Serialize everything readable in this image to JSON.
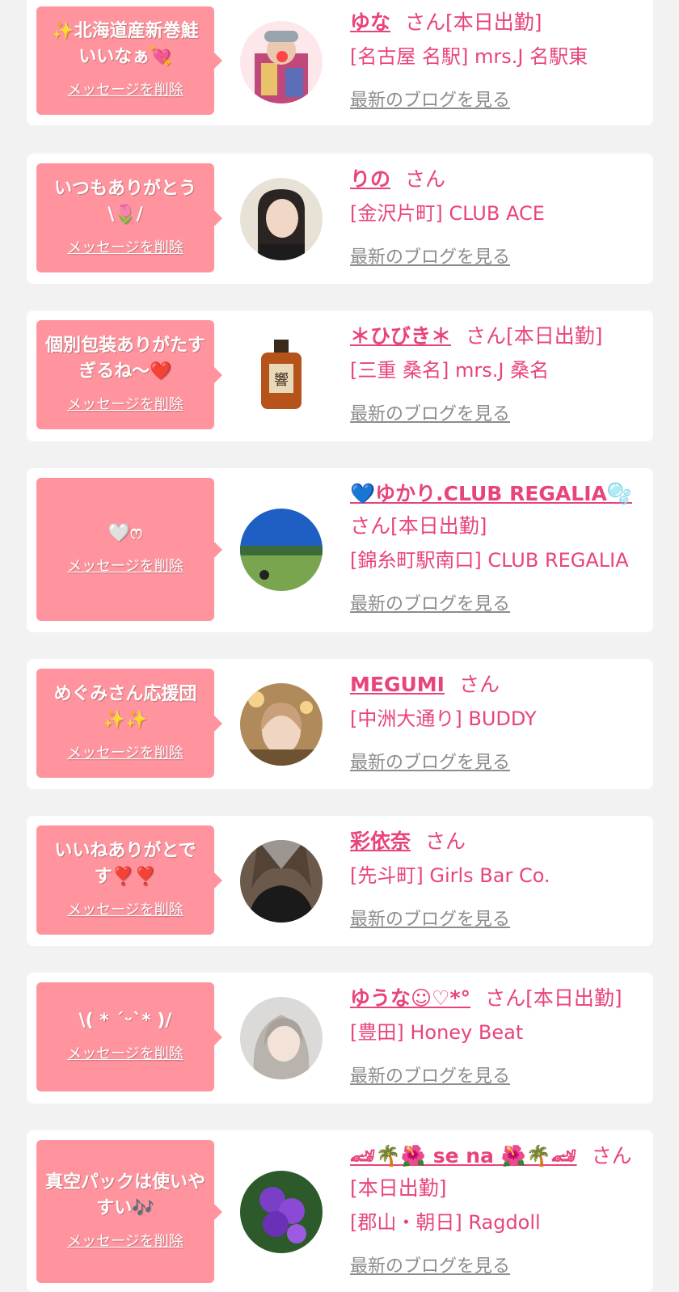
{
  "delete_label": "メッセージを削除",
  "blog_label": "最新のブログを見る",
  "cards": [
    {
      "message": "✨北海道産新巻鮭いいなぁ💘",
      "name": "ゆな",
      "suffix": "さん[本日出勤]",
      "shop": "[名古屋 名駅] mrs.J 名駅東"
    },
    {
      "message": "いつもありがとう\\🌷/",
      "name": "りの",
      "suffix": "さん",
      "shop": "[金沢片町] CLUB ACE"
    },
    {
      "message": "個別包装ありがたすぎるね〜❤️",
      "name": "＊ひびき＊",
      "suffix": "さん[本日出勤]",
      "shop": "[三重 桑名] mrs.J 桑名"
    },
    {
      "message": "🤍ෆ",
      "name": "💙ゆかり.CLUB REGALIA🫧",
      "suffix": "さん[本日出勤]",
      "shop": "[錦糸町駅南口] CLUB REGALIA"
    },
    {
      "message": "めぐみさん応援団✨✨",
      "name": "MEGUMI",
      "suffix": "さん",
      "shop": "[中洲大通り] BUDDY"
    },
    {
      "message": "いいねありがとです❣️❣️",
      "name": "彩依奈",
      "suffix": "さん",
      "shop": "[先斗町] Girls Bar Co."
    },
    {
      "message": "\\( * ˊᵕˋ* )/",
      "name": "ゆうな☺︎♡*°",
      "suffix": "さん[本日出勤]",
      "shop": "[豊田] Honey Beat"
    },
    {
      "message": "真空パックは使いやすい🎶",
      "name": "🏎🌴🌺 se na 🌺🌴🏎",
      "suffix": "さん[本日出勤]",
      "shop": "[郡山・朝日] Ragdoll"
    }
  ]
}
